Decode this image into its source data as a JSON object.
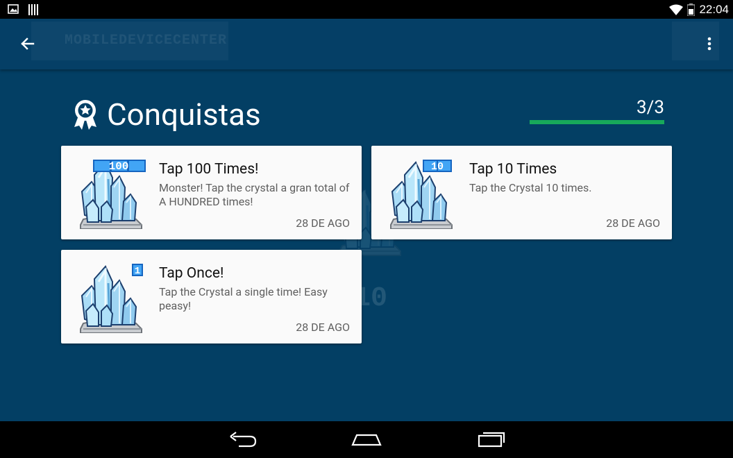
{
  "status_bar": {
    "time": "22:04",
    "icons": [
      "image-notification-icon",
      "barcode-notification-icon",
      "wifi-icon",
      "battery-icon"
    ]
  },
  "app_bar": {
    "back_icon": "arrow-back-icon",
    "menu_icon": "more-vert-icon",
    "banner_text": "MOBILEDEVICECENTER"
  },
  "header": {
    "icon": "award-ribbon-icon",
    "title": "Conquistas",
    "progress_text": "3/3",
    "progress_fraction": 1.0
  },
  "achievements": [
    {
      "title": "Tap 100 Times!",
      "description": "Monster! Tap the crystal a gran total of A HUNDRED times!",
      "date": "28 DE AGO",
      "badge": "100",
      "icon": "crystal-cluster-icon"
    },
    {
      "title": "Tap 10 Times",
      "description": "Tap the Crystal 10 times.",
      "date": "28 DE AGO",
      "badge": "10",
      "icon": "crystal-cluster-icon"
    },
    {
      "title": "Tap Once!",
      "description": "Tap the Crystal a single time! Easy peasy!",
      "date": "28 DE AGO",
      "badge": "1",
      "icon": "crystal-cluster-icon"
    }
  ],
  "nav_bar": {
    "buttons": [
      "back-nav-icon",
      "home-nav-icon",
      "recents-nav-icon"
    ]
  },
  "colors": {
    "background": "#033f64",
    "progress_fill": "#18a85a",
    "card": "#fafafa",
    "badge_blue": "#1e88e5"
  }
}
